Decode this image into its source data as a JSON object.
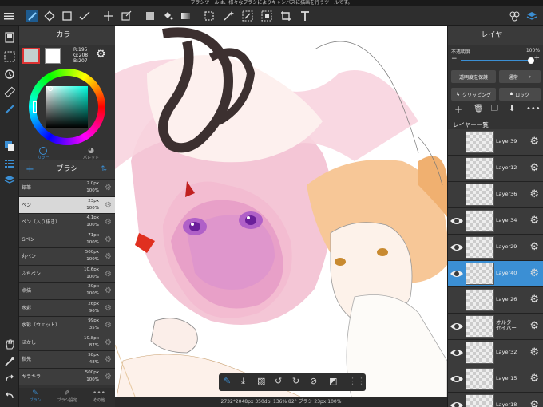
{
  "status_bar": {
    "hint": "ブラシツールは、様々なブラシによりキャンバスに描画を行うツールです。"
  },
  "toolbar": {
    "tools": [
      "brush-icon",
      "eraser-icon",
      "rect-shape-icon",
      "magic-wand-icon",
      "move-icon",
      "transform-icon",
      "fill-color-icon",
      "bucket-icon",
      "gradient-icon",
      "select-rect-icon",
      "auto-select-icon",
      "select-pen-icon",
      "select-eraser-icon",
      "crop-icon",
      "text-icon"
    ],
    "right_icons": [
      "material-icon",
      "layers-icon"
    ]
  },
  "color_panel": {
    "title": "カラー",
    "rgb": {
      "r": "R:195",
      "g": "G:208",
      "b": "B:207"
    },
    "tabs": [
      {
        "label": "カラー"
      },
      {
        "label": "パレット"
      }
    ]
  },
  "brush_panel": {
    "title": "ブラシ",
    "brushes": [
      {
        "name": "鉛筆",
        "size": "2.0px",
        "opacity": "100%"
      },
      {
        "name": "ペン",
        "size": "23px",
        "opacity": "100%"
      },
      {
        "name": "ペン（入り抜き）",
        "size": "4.1px",
        "opacity": "100%"
      },
      {
        "name": "Gペン",
        "size": "71px",
        "opacity": "100%"
      },
      {
        "name": "丸ペン",
        "size": "500px",
        "opacity": "100%"
      },
      {
        "name": "ふちペン",
        "size": "10.6px",
        "opacity": "100%"
      },
      {
        "name": "点描",
        "size": "20px",
        "opacity": "100%"
      },
      {
        "name": "水彩",
        "size": "26px",
        "opacity": "96%"
      },
      {
        "name": "水彩（ウェット）",
        "size": "99px",
        "opacity": "35%"
      },
      {
        "name": "ぼかし",
        "size": "10.8px",
        "opacity": "87%"
      },
      {
        "name": "指先",
        "size": "58px",
        "opacity": "48%"
      },
      {
        "name": "キラキラ",
        "size": "500px",
        "opacity": "100%"
      }
    ],
    "bottom_tabs": [
      {
        "label": "ブラシ"
      },
      {
        "label": "ブラシ設定"
      },
      {
        "label": "その他"
      }
    ]
  },
  "layer_panel": {
    "title": "レイヤー",
    "opacity_label": "不透明度",
    "opacity_value": "100%",
    "opacity_fraction": 1.0,
    "protect_alpha_label": "透明度を保護",
    "blend_mode_label": "通常",
    "clipping_label": "クリッピング",
    "lock_label": "ロック",
    "list_title": "レイヤー一覧",
    "layers": [
      {
        "name": "Layer39",
        "visible": false,
        "selected": false
      },
      {
        "name": "Layer12",
        "visible": false,
        "selected": false
      },
      {
        "name": "Layer36",
        "visible": false,
        "selected": false
      },
      {
        "name": "Layer34",
        "visible": true,
        "selected": false
      },
      {
        "name": "Layer29",
        "visible": true,
        "selected": false
      },
      {
        "name": "Layer40",
        "visible": true,
        "selected": true
      },
      {
        "name": "Layer26",
        "visible": false,
        "selected": false
      },
      {
        "name": "オルタ\nセイバー",
        "visible": true,
        "selected": false
      },
      {
        "name": "Layer32",
        "visible": true,
        "selected": false
      },
      {
        "name": "Layer15",
        "visible": true,
        "selected": false
      },
      {
        "name": "Layer18",
        "visible": true,
        "selected": false
      }
    ]
  },
  "canvas": {
    "info": "2732*2048px 350dpi 136% 82° ブラシ 23px 100%"
  },
  "colors": {
    "accent": "#3b8fd4",
    "current_color": "#c3d0cf"
  }
}
